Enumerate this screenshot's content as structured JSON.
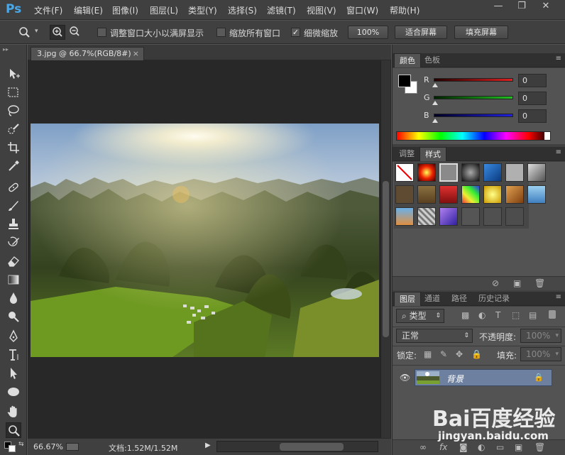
{
  "app": {
    "logo": "Ps"
  },
  "menu": [
    "文件(F)",
    "编辑(E)",
    "图像(I)",
    "图层(L)",
    "类型(Y)",
    "选择(S)",
    "滤镜(T)",
    "视图(V)",
    "窗口(W)",
    "帮助(H)"
  ],
  "window_controls": {
    "minimize": "—",
    "restore": "❐",
    "close": "✕"
  },
  "options": {
    "resize_windows_label": "调整窗口大小以满屏显示",
    "zoom_all_windows_label": "缩放所有窗口",
    "scrubby_zoom_label": "细微缩放",
    "scrubby_zoom_checked": true,
    "zoom_100_label": "100%",
    "fit_screen_label": "适合屏幕",
    "fill_screen_label": "填充屏幕"
  },
  "document": {
    "tab_title": "3.jpg @ 66.7%(RGB/8#)",
    "tab_close": "×",
    "zoom_level": "66.67%",
    "doc_size": "文档:1.52M/1.52M"
  },
  "color_panel": {
    "tabs": [
      "颜色",
      "色板"
    ],
    "active_tab": "颜色",
    "foreground": "#000000",
    "background": "#ffffff",
    "channels": [
      {
        "label": "R",
        "value": "0",
        "color": "#e02020"
      },
      {
        "label": "G",
        "value": "0",
        "color": "#20c020"
      },
      {
        "label": "B",
        "value": "0",
        "color": "#2020e0"
      }
    ]
  },
  "styles_panel": {
    "tabs": [
      "调整",
      "样式"
    ],
    "active_tab": "样式"
  },
  "layers_panel": {
    "tabs": [
      "图层",
      "通道",
      "路径",
      "历史记录"
    ],
    "active_tab": "图层",
    "filter_kind": "类型",
    "blend_mode": "正常",
    "opacity_label": "不透明度:",
    "opacity_value": "100%",
    "lock_label": "锁定:",
    "fill_label": "填充:",
    "fill_value": "100%",
    "layers": [
      {
        "name": "背景",
        "visible": true,
        "locked": true
      }
    ]
  },
  "watermark": {
    "brand": "Bai百度经验",
    "url": "jingyan.baidu.com"
  }
}
